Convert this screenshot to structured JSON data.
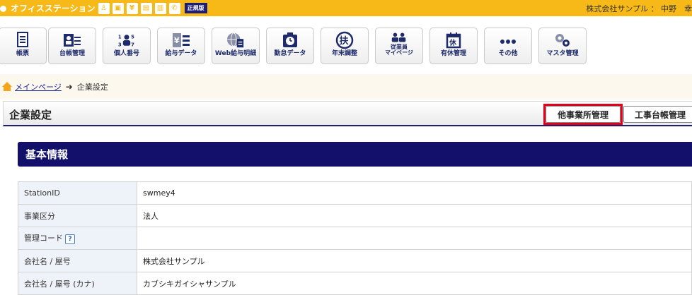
{
  "app": {
    "logo_text": "オフィスステーション",
    "edition": "正規版",
    "user": "株式会社サンプル ： 中野　幸"
  },
  "menu": [
    {
      "label": "帳票",
      "icon": "document-icon"
    },
    {
      "label": "台帳管理",
      "icon": "ledger-icon"
    },
    {
      "label": "個人番号",
      "icon": "personal-number-icon"
    },
    {
      "label": "給与データ",
      "icon": "payroll-data-icon"
    },
    {
      "label": "Web給与明細",
      "icon": "web-payslip-icon"
    },
    {
      "label": "勤怠データ",
      "icon": "attendance-icon"
    },
    {
      "label": "年末調整",
      "icon": "year-end-adjustment-icon"
    },
    {
      "label": "従業員\nマイページ",
      "icon": "employee-mypage-icon"
    },
    {
      "label": "有休管理",
      "icon": "paid-leave-icon"
    },
    {
      "label": "その他",
      "icon": "more-icon"
    },
    {
      "label": "マスタ管理",
      "icon": "settings-icon"
    }
  ],
  "breadcrumb": {
    "home": "メインページ",
    "current": "企業設定"
  },
  "page": {
    "title": "企業設定",
    "btn_other_office": "他事業所管理",
    "btn_construction": "工事台帳管理"
  },
  "section": {
    "title": "基本情報"
  },
  "table": [
    {
      "label": "StationID",
      "value": "swmey4"
    },
    {
      "label": "事業区分",
      "value": "法人"
    },
    {
      "label": "管理コード",
      "value": "",
      "help": "?"
    },
    {
      "label": "会社名 / 屋号",
      "value": "株式会社サンプル"
    },
    {
      "label": "会社名 / 屋号 (カナ)",
      "value": "カブシキガイシャサンプル"
    }
  ],
  "colors": {
    "accent": "#f6b918",
    "navy": "#12106a",
    "highlight": "#e0001a"
  }
}
